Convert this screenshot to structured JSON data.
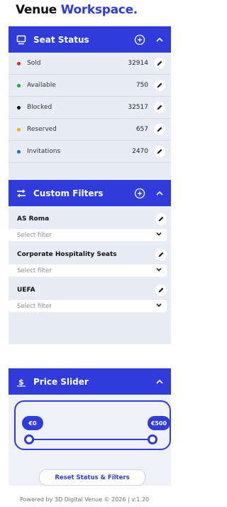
{
  "brand": {
    "word1": "Venue",
    "word2": "Workspace."
  },
  "seat_status": {
    "title": "Seat Status",
    "icon": "monitor-icon",
    "rows": [
      {
        "label": "Sold",
        "count": "32914",
        "color": "#e02424"
      },
      {
        "label": "Available",
        "count": "750",
        "color": "#16a34a"
      },
      {
        "label": "Blocked",
        "count": "32517",
        "color": "#111111"
      },
      {
        "label": "Reserved",
        "count": "657",
        "color": "#f5b400"
      },
      {
        "label": "Invitations",
        "count": "2470",
        "color": "#1d6fd6"
      }
    ]
  },
  "custom_filters": {
    "title": "Custom Filters",
    "icon": "shuffle-icon",
    "groups": [
      {
        "title": "AS Roma",
        "placeholder": "Select filter"
      },
      {
        "title": "Corporate Hospitality Seats",
        "placeholder": "Select filter"
      },
      {
        "title": "UEFA",
        "placeholder": "Select filter"
      }
    ]
  },
  "price_slider": {
    "title": "Price Slider",
    "icon": "dollar-person-icon",
    "min_label": "€0",
    "max_label": "€500"
  },
  "reset_label": "Reset Status & Filters",
  "footer": "Powered by 3D Digital Venue © 2026 | v:1.20",
  "colors": {
    "accent": "#2f3bdc",
    "panel_bg": "#e8ecf4"
  }
}
